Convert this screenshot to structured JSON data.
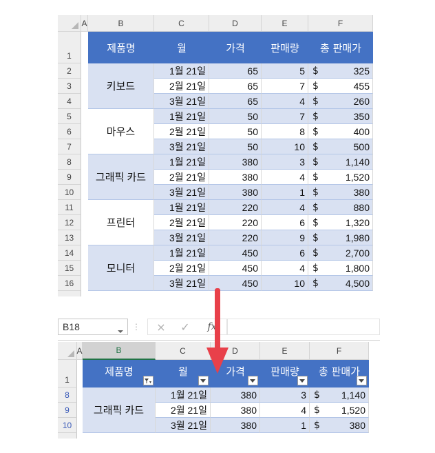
{
  "top_sheet": {
    "columns": [
      "A",
      "B",
      "C",
      "D",
      "E",
      "F"
    ],
    "row_numbers": [
      "1",
      "2",
      "3",
      "4",
      "5",
      "6",
      "7",
      "8",
      "9",
      "10",
      "11",
      "12",
      "13",
      "14",
      "15",
      "16"
    ],
    "headers": [
      "제품명",
      "월",
      "가격",
      "판매량",
      "총 판매가"
    ],
    "groups": [
      {
        "product": "키보드",
        "rows": [
          {
            "month": "1월 21일",
            "price": "65",
            "qty": "5",
            "cur": "$",
            "total": "325"
          },
          {
            "month": "2월 21일",
            "price": "65",
            "qty": "7",
            "cur": "$",
            "total": "455"
          },
          {
            "month": "3월 21일",
            "price": "65",
            "qty": "4",
            "cur": "$",
            "total": "260"
          }
        ]
      },
      {
        "product": "마우스",
        "rows": [
          {
            "month": "1월 21일",
            "price": "50",
            "qty": "7",
            "cur": "$",
            "total": "350"
          },
          {
            "month": "2월 21일",
            "price": "50",
            "qty": "8",
            "cur": "$",
            "total": "400"
          },
          {
            "month": "3월 21일",
            "price": "50",
            "qty": "10",
            "cur": "$",
            "total": "500"
          }
        ]
      },
      {
        "product": "그래픽 카드",
        "rows": [
          {
            "month": "1월 21일",
            "price": "380",
            "qty": "3",
            "cur": "$",
            "total": "1,140"
          },
          {
            "month": "2월 21일",
            "price": "380",
            "qty": "4",
            "cur": "$",
            "total": "1,520"
          },
          {
            "month": "3월 21일",
            "price": "380",
            "qty": "1",
            "cur": "$",
            "total": "380"
          }
        ]
      },
      {
        "product": "프린터",
        "rows": [
          {
            "month": "1월 21일",
            "price": "220",
            "qty": "4",
            "cur": "$",
            "total": "880"
          },
          {
            "month": "2월 21일",
            "price": "220",
            "qty": "6",
            "cur": "$",
            "total": "1,320"
          },
          {
            "month": "3월 21일",
            "price": "220",
            "qty": "9",
            "cur": "$",
            "total": "1,980"
          }
        ]
      },
      {
        "product": "모니터",
        "rows": [
          {
            "month": "1월 21일",
            "price": "450",
            "qty": "6",
            "cur": "$",
            "total": "2,700"
          },
          {
            "month": "2월 21일",
            "price": "450",
            "qty": "4",
            "cur": "$",
            "total": "1,800"
          },
          {
            "month": "3월 21일",
            "price": "450",
            "qty": "10",
            "cur": "$",
            "total": "4,500"
          }
        ]
      }
    ]
  },
  "formula_bar": {
    "name_box": "B18",
    "cancel_icon": "×",
    "enter_icon": "✓",
    "fx_label": "fx",
    "formula": ""
  },
  "bottom_sheet": {
    "columns": [
      "A",
      "B",
      "C",
      "D",
      "E",
      "F"
    ],
    "row_numbers": [
      "1",
      "8",
      "9",
      "10"
    ],
    "headers": [
      "제품명",
      "월",
      "가격",
      "판매량",
      "총 판매가"
    ],
    "product": "그래픽 카드",
    "rows": [
      {
        "month": "1월 21일",
        "price": "380",
        "qty": "3",
        "cur": "$",
        "total": "1,140"
      },
      {
        "month": "2월 21일",
        "price": "380",
        "qty": "4",
        "cur": "$",
        "total": "1,520"
      },
      {
        "month": "3월 21일",
        "price": "380",
        "qty": "1",
        "cur": "$",
        "total": "380"
      }
    ]
  },
  "colors": {
    "header_fill": "#4472c4",
    "band_fill": "#d9e1f2",
    "arrow": "#e8404a",
    "filtered_row_number": "#3a5ab8"
  },
  "arrow_icon": "down-arrow-icon"
}
